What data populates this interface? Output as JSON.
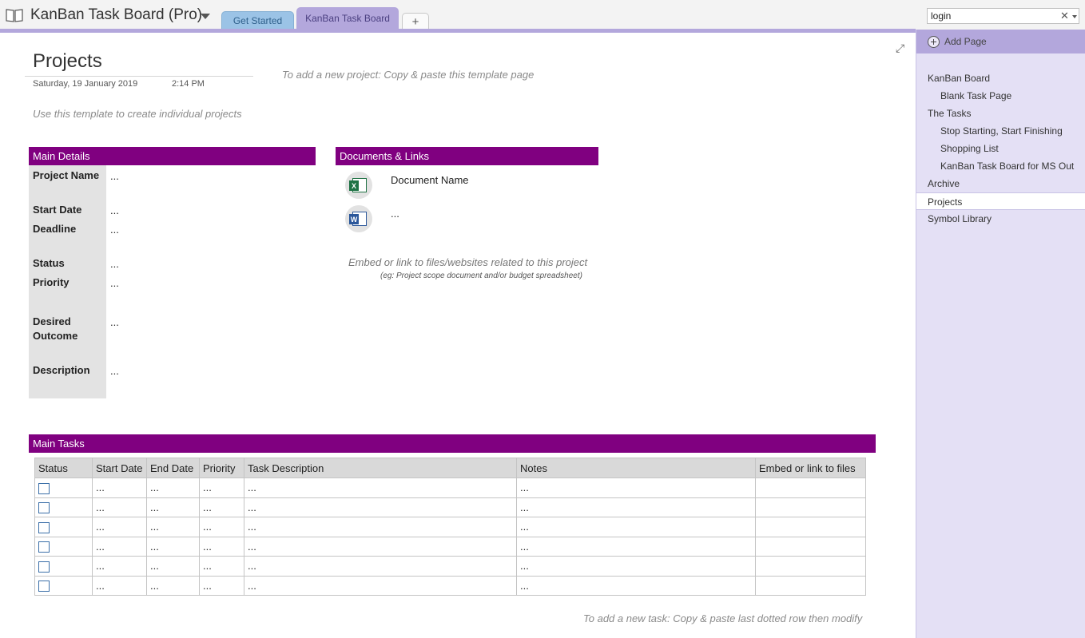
{
  "app": {
    "notebook_title": "KanBan Task Board (Pro)",
    "tabs": [
      {
        "label": "Get Started"
      },
      {
        "label": "KanBan Task Board"
      },
      {
        "label": "+"
      }
    ],
    "search": {
      "value": "login",
      "clear_glyph": "✕"
    }
  },
  "sidebar": {
    "add_page_label": "Add Page",
    "pages": [
      {
        "label": "KanBan Board",
        "level": 1
      },
      {
        "label": "Blank Task Page",
        "level": 2
      },
      {
        "label": "The Tasks",
        "level": 1
      },
      {
        "label": "Stop Starting, Start Finishing",
        "level": 2
      },
      {
        "label": "Shopping List",
        "level": 2
      },
      {
        "label": "KanBan Task Board for MS Out",
        "level": 2
      },
      {
        "label": "Archive",
        "level": 1
      },
      {
        "label": "Projects",
        "level": 1,
        "active": true
      },
      {
        "label": "Symbol Library",
        "level": 1
      }
    ]
  },
  "page": {
    "title": "Projects",
    "date": "Saturday, 19 January 2019",
    "time": "2:14 PM",
    "hint_new_project": "To add a new project: Copy & paste this template page",
    "hint_template": "Use this template to create individual projects",
    "hint_new_task": "To add a new task: Copy & paste last dotted row then modify"
  },
  "main_details": {
    "header": "Main Details",
    "fields": {
      "project_name": {
        "label": "Project Name",
        "value": "..."
      },
      "start_date": {
        "label": "Start Date",
        "value": "..."
      },
      "deadline": {
        "label": "Deadline",
        "value": "..."
      },
      "status": {
        "label": "Status",
        "value": "..."
      },
      "priority": {
        "label": "Priority",
        "value": "..."
      },
      "desired_outcome": {
        "label_line1": "Desired",
        "label_line2": "Outcome",
        "value": "..."
      },
      "description": {
        "label": "Description",
        "value": "..."
      }
    }
  },
  "documents": {
    "header": "Documents & Links",
    "items": [
      {
        "icon": "excel-icon",
        "badge": "X",
        "name": "Document Name"
      },
      {
        "icon": "word-icon",
        "badge": "W",
        "name": "..."
      }
    ],
    "hint": "Embed  or link to files/websites related to this project",
    "hint_sub": "(eg: Project scope document and/or budget spreadsheet)"
  },
  "tasks": {
    "header": "Main Tasks",
    "columns": [
      "Status",
      "Start Date",
      "End Date",
      "Priority",
      "Task Description",
      "Notes",
      "Embed or link to files"
    ],
    "rows": [
      {
        "start": "...",
        "end": "...",
        "priority": "...",
        "description": "...",
        "notes": "...",
        "files": ""
      },
      {
        "start": "...",
        "end": "...",
        "priority": "...",
        "description": "...",
        "notes": "...",
        "files": ""
      },
      {
        "start": "...",
        "end": "...",
        "priority": "...",
        "description": "...",
        "notes": "...",
        "files": ""
      },
      {
        "start": "...",
        "end": "...",
        "priority": "...",
        "description": "...",
        "notes": "...",
        "files": ""
      },
      {
        "start": "...",
        "end": "...",
        "priority": "...",
        "description": "...",
        "notes": "...",
        "files": ""
      },
      {
        "start": "...",
        "end": "...",
        "priority": "...",
        "description": "...",
        "notes": "...",
        "files": ""
      }
    ]
  },
  "colors": {
    "section_header": "#800080",
    "tab_accent": "#b3a7dc",
    "sidebar_bg": "#e4e0f5"
  }
}
